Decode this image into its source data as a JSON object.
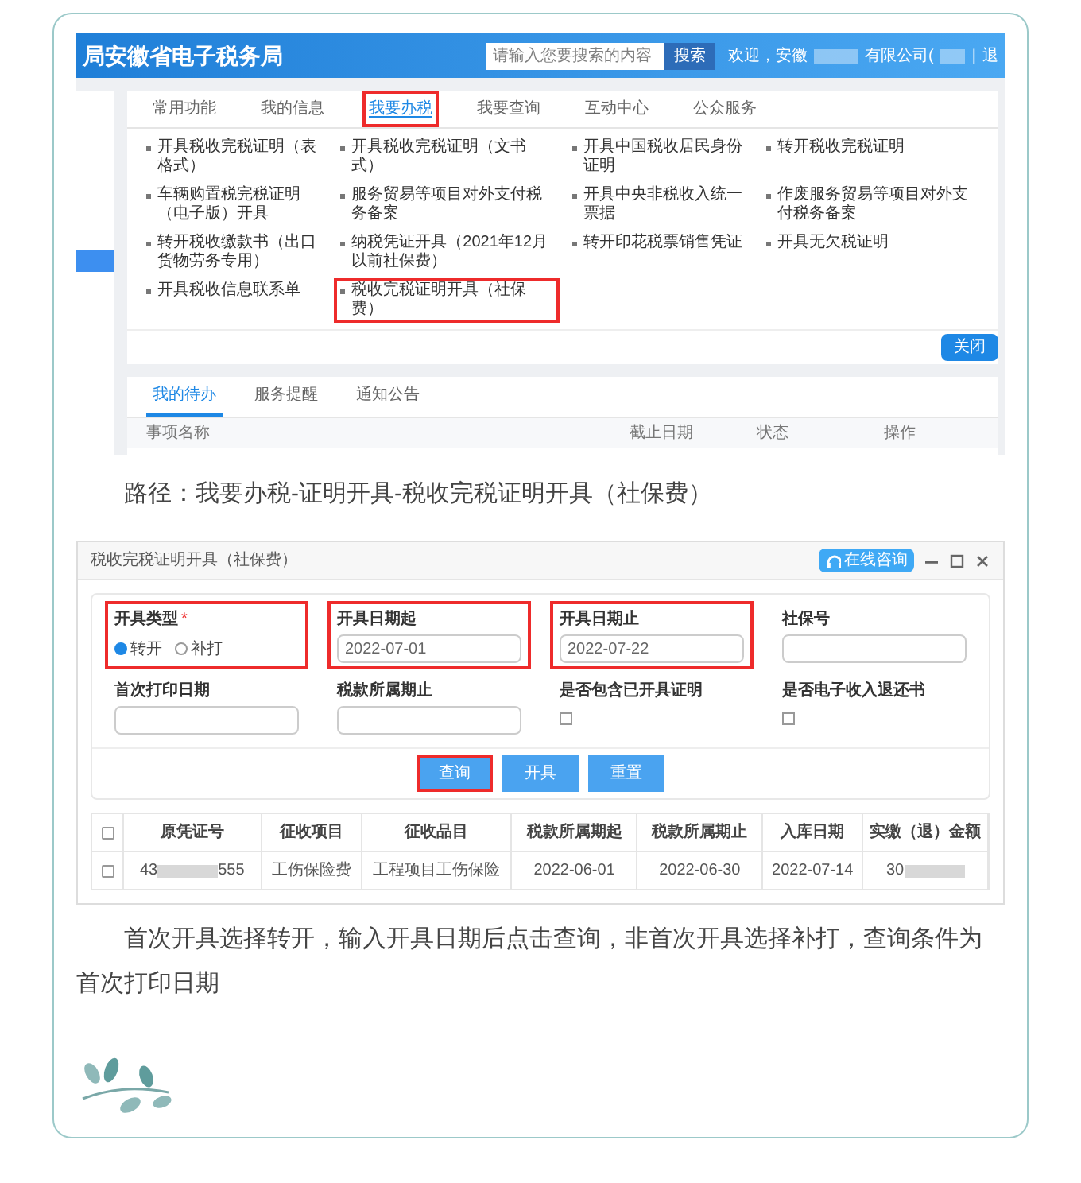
{
  "screenshot_1": {
    "site_title": "局安徽省电子税务局",
    "search": {
      "placeholder": "请输入您要搜索的内容",
      "button": "搜索"
    },
    "user": {
      "greeting": "欢迎，安徽",
      "company_suffix": "有限公司(",
      "separator": "|",
      "logout": "退"
    },
    "tabs": [
      {
        "label": "常用功能",
        "selected": false,
        "highlighted": false
      },
      {
        "label": "我的信息",
        "selected": false,
        "highlighted": false
      },
      {
        "label": "我要办税",
        "selected": true,
        "highlighted": true
      },
      {
        "label": "我要查询",
        "selected": false,
        "highlighted": false
      },
      {
        "label": "互动中心",
        "selected": false,
        "highlighted": false
      },
      {
        "label": "公众服务",
        "selected": false,
        "highlighted": false
      }
    ],
    "menu_items": [
      {
        "label": "开具税收完税证明（表格式）",
        "highlighted": false
      },
      {
        "label": "开具税收完税证明（文书式）",
        "highlighted": false
      },
      {
        "label": "开具中国税收居民身份证明",
        "highlighted": false
      },
      {
        "label": "转开税收完税证明",
        "highlighted": false
      },
      {
        "label": "车辆购置税完税证明（电子版）开具",
        "highlighted": false
      },
      {
        "label": "服务贸易等项目对外支付税务备案",
        "highlighted": false
      },
      {
        "label": "开具中央非税收入统一票据",
        "highlighted": false
      },
      {
        "label": "作废服务贸易等项目对外支付税务备案",
        "highlighted": false
      },
      {
        "label": "转开税收缴款书（出口货物劳务专用）",
        "highlighted": false
      },
      {
        "label": "纳税凭证开具（2021年12月以前社保费）",
        "highlighted": false
      },
      {
        "label": "转开印花税票销售凭证",
        "highlighted": false
      },
      {
        "label": "开具无欠税证明",
        "highlighted": false
      },
      {
        "label": "开具税收信息联系单",
        "highlighted": false
      },
      {
        "label": "税收完税证明开具（社保费）",
        "highlighted": true
      }
    ],
    "close_button": "关闭",
    "bottom_tabs": [
      {
        "label": "我的待办",
        "selected": true
      },
      {
        "label": "服务提醒",
        "selected": false
      },
      {
        "label": "通知公告",
        "selected": false
      }
    ],
    "table_columns": [
      "事项名称",
      "截止日期",
      "状态",
      "操作"
    ]
  },
  "caption_1": "路径：我要办税-证明开具-税收完税证明开具（社保费）",
  "screenshot_2": {
    "dialog_title": "税收完税证明开具（社保费）",
    "online_help": "在线咨询",
    "fields": [
      {
        "kind": "radio",
        "label": "开具类型",
        "required_mark": "*",
        "highlighted": true,
        "options": [
          {
            "label": "转开",
            "selected": true
          },
          {
            "label": "补打",
            "selected": false
          }
        ]
      },
      {
        "kind": "text",
        "label": "开具日期起",
        "value": "2022-07-01",
        "highlighted": true
      },
      {
        "kind": "text",
        "label": "开具日期止",
        "value": "2022-07-22",
        "highlighted": true
      },
      {
        "kind": "text",
        "label": "社保号",
        "highlighted": false
      },
      {
        "kind": "text",
        "label": "首次打印日期",
        "highlighted": false
      },
      {
        "kind": "text",
        "label": "税款所属期止",
        "highlighted": false
      },
      {
        "kind": "checkbox",
        "label": "是否包含已开具证明",
        "checked": false,
        "highlighted": false
      },
      {
        "kind": "checkbox",
        "label": "是否电子收入退还书",
        "checked": false,
        "highlighted": false
      }
    ],
    "buttons": [
      {
        "label": "查询",
        "highlighted": true
      },
      {
        "label": "开具",
        "highlighted": false
      },
      {
        "label": "重置",
        "highlighted": false
      }
    ],
    "table": {
      "select_all": false,
      "columns": [
        "原凭证号",
        "征收项目",
        "征收品目",
        "税款所属期起",
        "税款所属期止",
        "入库日期",
        "实缴（退）金额"
      ],
      "rows": [
        {
          "selected": false,
          "cells": [
            {
              "kind": "masked",
              "start": "43",
              "end": "555"
            },
            {
              "kind": "text",
              "text": "工伤保险费"
            },
            {
              "kind": "text",
              "text": "工程项目工伤保险"
            },
            {
              "kind": "text",
              "text": "2022-06-01"
            },
            {
              "kind": "text",
              "text": "2022-06-30"
            },
            {
              "kind": "text",
              "text": "2022-07-14"
            },
            {
              "kind": "masked",
              "start": "30"
            }
          ]
        }
      ]
    }
  },
  "caption_2": "首次开具选择转开，输入开具日期后点击查询，非首次开具选择补打，查询条件为首次打印日期"
}
